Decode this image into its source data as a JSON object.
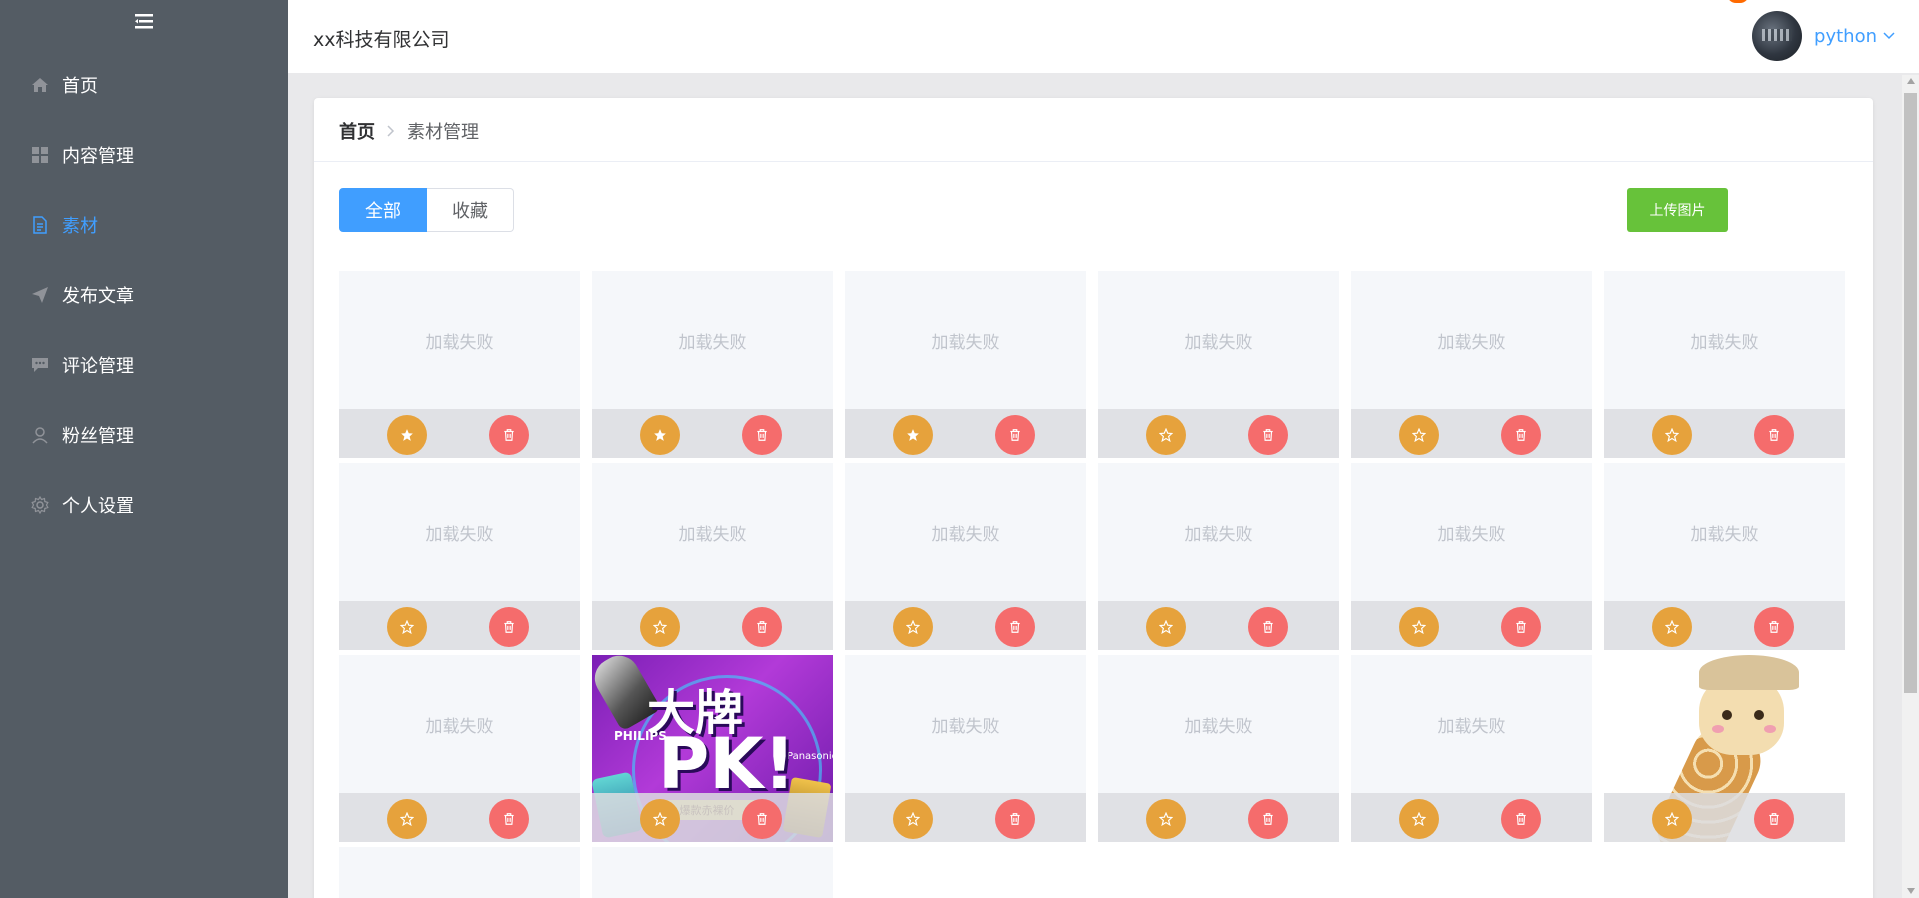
{
  "sidebar": {
    "items": [
      {
        "label": "首页",
        "icon": "home-icon",
        "active": false
      },
      {
        "label": "内容管理",
        "icon": "grid-icon",
        "active": false
      },
      {
        "label": "素材",
        "icon": "document-icon",
        "active": true
      },
      {
        "label": "发布文章",
        "icon": "send-icon",
        "active": false
      },
      {
        "label": "评论管理",
        "icon": "comment-icon",
        "active": false
      },
      {
        "label": "粉丝管理",
        "icon": "user-icon",
        "active": false
      },
      {
        "label": "个人设置",
        "icon": "gear-icon",
        "active": false
      }
    ]
  },
  "header": {
    "company": "xx科技有限公司",
    "username": "python"
  },
  "breadcrumb": {
    "home": "首页",
    "current": "素材管理"
  },
  "tabs": {
    "all": "全部",
    "favorites": "收藏"
  },
  "upload_button": "上传图片",
  "materials": {
    "fail_text": "加载失败",
    "tiles": [
      {
        "kind": "failed",
        "favorited": true
      },
      {
        "kind": "failed",
        "favorited": true
      },
      {
        "kind": "failed",
        "favorited": true
      },
      {
        "kind": "failed",
        "favorited": false
      },
      {
        "kind": "failed",
        "favorited": false
      },
      {
        "kind": "failed",
        "favorited": false
      },
      {
        "kind": "failed",
        "favorited": false
      },
      {
        "kind": "failed",
        "favorited": false
      },
      {
        "kind": "failed",
        "favorited": false
      },
      {
        "kind": "failed",
        "favorited": false
      },
      {
        "kind": "failed",
        "favorited": false
      },
      {
        "kind": "failed",
        "favorited": false
      },
      {
        "kind": "failed",
        "favorited": false
      },
      {
        "kind": "poster",
        "favorited": false
      },
      {
        "kind": "failed",
        "favorited": false
      },
      {
        "kind": "failed",
        "favorited": false
      },
      {
        "kind": "failed",
        "favorited": false
      },
      {
        "kind": "giraffe",
        "favorited": false
      }
    ]
  },
  "poster": {
    "title": "大牌",
    "pk": "PK!",
    "brand_left": "PHILIPS",
    "brand_right": "Panasonic",
    "strip": "爆款赤裸价"
  },
  "colors": {
    "sidebar_bg": "#545c64",
    "active": "#409eff",
    "upload": "#67c23a",
    "favorite": "#e6a23c",
    "delete": "#f56c6c"
  }
}
